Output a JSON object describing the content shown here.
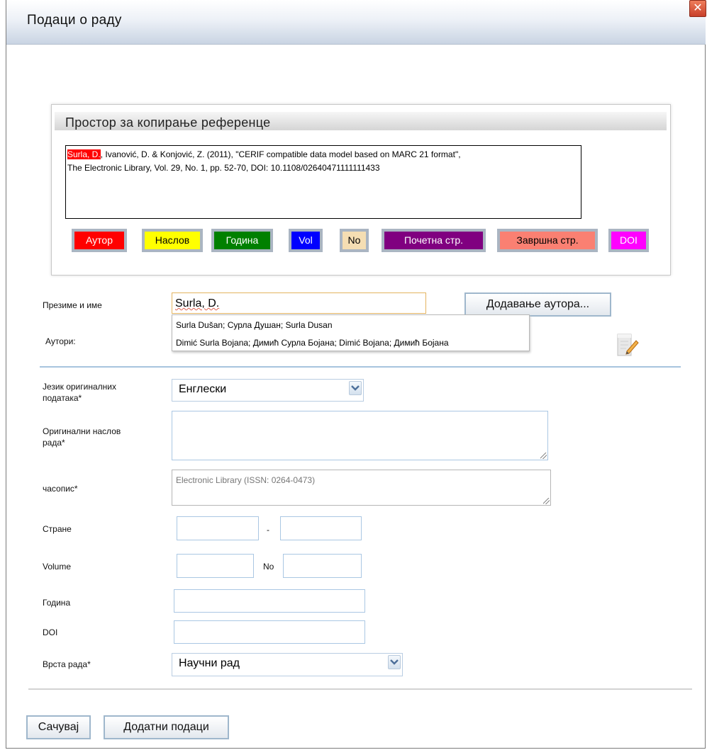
{
  "dialog": {
    "title": "Подаци о раду",
    "close_icon": "close-icon"
  },
  "reference_panel": {
    "heading": "Простор за копирање референце",
    "author_highlight": "Surla, D.",
    "text_line1_rest": ", Ivanović, D. & Konjović, Z. (2011), \"CERIF compatible data model based on MARC 21 format\",",
    "text_line2": "The Electronic Library, Vol. 29, No. 1, pp. 52-70, DOI: 10.1108/02640471111111433",
    "tags": [
      {
        "label": "Аутор",
        "bg": "#ff0000",
        "fg": "#ffffff"
      },
      {
        "label": "Наслов",
        "bg": "#ffff00",
        "fg": "#000000"
      },
      {
        "label": "Година",
        "bg": "#008000",
        "fg": "#ffffff"
      },
      {
        "label": "Vol",
        "bg": "#0000ff",
        "fg": "#ffffff"
      },
      {
        "label": "No",
        "bg": "#f5deb3",
        "fg": "#000000"
      },
      {
        "label": "Почетна стр.",
        "bg": "#800080",
        "fg": "#ffffff"
      },
      {
        "label": "Завршна стр.",
        "bg": "#fa8072",
        "fg": "#000000"
      },
      {
        "label": "DOI",
        "bg": "#ff00ff",
        "fg": "#ffffff"
      }
    ]
  },
  "form": {
    "surname_label": "Презиме и име",
    "surname_value": "Surla, D.",
    "add_author_button": "Додавање аутора...",
    "authors_label": "Аутори:",
    "suggestions": [
      "Surla Dušan; Сурла Душан; Surla Dusan",
      "Dimić Surla Bojana; Димић Сурла Бојана; Dimić Bojana; Димић Бојана"
    ],
    "language_label_line1": "Језик оригиналних",
    "language_label_line2": "података*",
    "language_value": "Енглески",
    "orig_title_label_line1": "Оригинални наслов",
    "orig_title_label_line2": "рада*",
    "journal_label": "часопис*",
    "journal_value": "Electronic Library (ISSN: 0264-0473)",
    "pages_label": "Стране",
    "pages_separator": "-",
    "volume_label": "Volume",
    "no_label": "No",
    "year_label": "Година",
    "doi_label": "DOI",
    "work_type_label": "Врста рада*",
    "work_type_value": "Научни рад"
  },
  "footer": {
    "save_button": "Сачувај",
    "additional_data_button": "Додатни подаци"
  }
}
